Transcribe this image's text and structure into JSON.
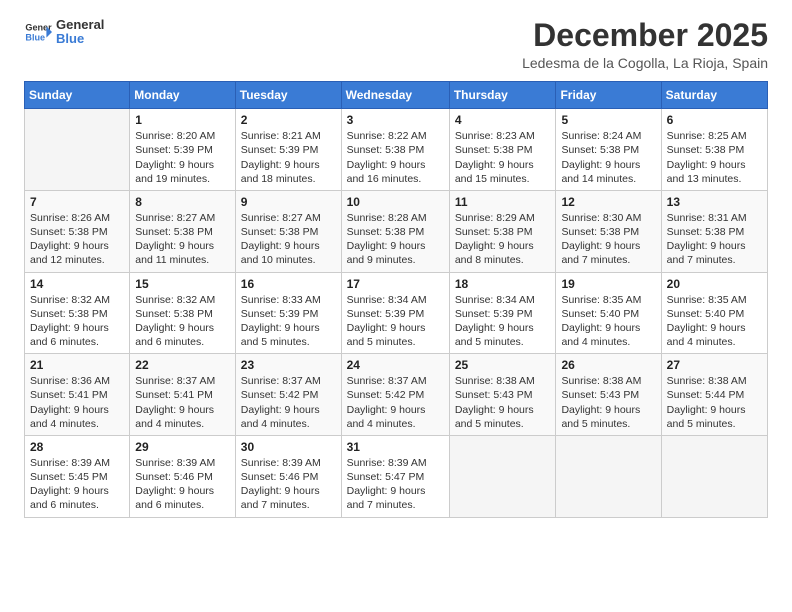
{
  "logo": {
    "line1": "General",
    "line2": "Blue"
  },
  "title": "December 2025",
  "location": "Ledesma de la Cogolla, La Rioja, Spain",
  "weekdays": [
    "Sunday",
    "Monday",
    "Tuesday",
    "Wednesday",
    "Thursday",
    "Friday",
    "Saturday"
  ],
  "weeks": [
    [
      {
        "day": "",
        "info": ""
      },
      {
        "day": "1",
        "info": "Sunrise: 8:20 AM\nSunset: 5:39 PM\nDaylight: 9 hours\nand 19 minutes."
      },
      {
        "day": "2",
        "info": "Sunrise: 8:21 AM\nSunset: 5:39 PM\nDaylight: 9 hours\nand 18 minutes."
      },
      {
        "day": "3",
        "info": "Sunrise: 8:22 AM\nSunset: 5:38 PM\nDaylight: 9 hours\nand 16 minutes."
      },
      {
        "day": "4",
        "info": "Sunrise: 8:23 AM\nSunset: 5:38 PM\nDaylight: 9 hours\nand 15 minutes."
      },
      {
        "day": "5",
        "info": "Sunrise: 8:24 AM\nSunset: 5:38 PM\nDaylight: 9 hours\nand 14 minutes."
      },
      {
        "day": "6",
        "info": "Sunrise: 8:25 AM\nSunset: 5:38 PM\nDaylight: 9 hours\nand 13 minutes."
      }
    ],
    [
      {
        "day": "7",
        "info": "Sunrise: 8:26 AM\nSunset: 5:38 PM\nDaylight: 9 hours\nand 12 minutes."
      },
      {
        "day": "8",
        "info": "Sunrise: 8:27 AM\nSunset: 5:38 PM\nDaylight: 9 hours\nand 11 minutes."
      },
      {
        "day": "9",
        "info": "Sunrise: 8:27 AM\nSunset: 5:38 PM\nDaylight: 9 hours\nand 10 minutes."
      },
      {
        "day": "10",
        "info": "Sunrise: 8:28 AM\nSunset: 5:38 PM\nDaylight: 9 hours\nand 9 minutes."
      },
      {
        "day": "11",
        "info": "Sunrise: 8:29 AM\nSunset: 5:38 PM\nDaylight: 9 hours\nand 8 minutes."
      },
      {
        "day": "12",
        "info": "Sunrise: 8:30 AM\nSunset: 5:38 PM\nDaylight: 9 hours\nand 7 minutes."
      },
      {
        "day": "13",
        "info": "Sunrise: 8:31 AM\nSunset: 5:38 PM\nDaylight: 9 hours\nand 7 minutes."
      }
    ],
    [
      {
        "day": "14",
        "info": "Sunrise: 8:32 AM\nSunset: 5:38 PM\nDaylight: 9 hours\nand 6 minutes."
      },
      {
        "day": "15",
        "info": "Sunrise: 8:32 AM\nSunset: 5:38 PM\nDaylight: 9 hours\nand 6 minutes."
      },
      {
        "day": "16",
        "info": "Sunrise: 8:33 AM\nSunset: 5:39 PM\nDaylight: 9 hours\nand 5 minutes."
      },
      {
        "day": "17",
        "info": "Sunrise: 8:34 AM\nSunset: 5:39 PM\nDaylight: 9 hours\nand 5 minutes."
      },
      {
        "day": "18",
        "info": "Sunrise: 8:34 AM\nSunset: 5:39 PM\nDaylight: 9 hours\nand 5 minutes."
      },
      {
        "day": "19",
        "info": "Sunrise: 8:35 AM\nSunset: 5:40 PM\nDaylight: 9 hours\nand 4 minutes."
      },
      {
        "day": "20",
        "info": "Sunrise: 8:35 AM\nSunset: 5:40 PM\nDaylight: 9 hours\nand 4 minutes."
      }
    ],
    [
      {
        "day": "21",
        "info": "Sunrise: 8:36 AM\nSunset: 5:41 PM\nDaylight: 9 hours\nand 4 minutes."
      },
      {
        "day": "22",
        "info": "Sunrise: 8:37 AM\nSunset: 5:41 PM\nDaylight: 9 hours\nand 4 minutes."
      },
      {
        "day": "23",
        "info": "Sunrise: 8:37 AM\nSunset: 5:42 PM\nDaylight: 9 hours\nand 4 minutes."
      },
      {
        "day": "24",
        "info": "Sunrise: 8:37 AM\nSunset: 5:42 PM\nDaylight: 9 hours\nand 4 minutes."
      },
      {
        "day": "25",
        "info": "Sunrise: 8:38 AM\nSunset: 5:43 PM\nDaylight: 9 hours\nand 5 minutes."
      },
      {
        "day": "26",
        "info": "Sunrise: 8:38 AM\nSunset: 5:43 PM\nDaylight: 9 hours\nand 5 minutes."
      },
      {
        "day": "27",
        "info": "Sunrise: 8:38 AM\nSunset: 5:44 PM\nDaylight: 9 hours\nand 5 minutes."
      }
    ],
    [
      {
        "day": "28",
        "info": "Sunrise: 8:39 AM\nSunset: 5:45 PM\nDaylight: 9 hours\nand 6 minutes."
      },
      {
        "day": "29",
        "info": "Sunrise: 8:39 AM\nSunset: 5:46 PM\nDaylight: 9 hours\nand 6 minutes."
      },
      {
        "day": "30",
        "info": "Sunrise: 8:39 AM\nSunset: 5:46 PM\nDaylight: 9 hours\nand 7 minutes."
      },
      {
        "day": "31",
        "info": "Sunrise: 8:39 AM\nSunset: 5:47 PM\nDaylight: 9 hours\nand 7 minutes."
      },
      {
        "day": "",
        "info": ""
      },
      {
        "day": "",
        "info": ""
      },
      {
        "day": "",
        "info": ""
      }
    ]
  ]
}
